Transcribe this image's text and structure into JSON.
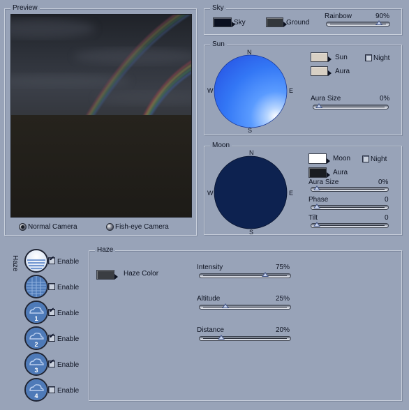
{
  "preview": {
    "title": "Preview",
    "normal_camera_label": "Normal Camera",
    "fisheye_camera_label": "Fish-eye Camera",
    "selected_camera": "normal"
  },
  "sky": {
    "title": "Sky",
    "sky_label": "Sky",
    "sky_color": "#0a1020",
    "ground_label": "Ground",
    "ground_color": "#33373c",
    "rainbow_label": "Rainbow",
    "rainbow_value": "90%",
    "rainbow_level": 0.9
  },
  "sun": {
    "title": "Sun",
    "sun_label": "Sun",
    "sun_color": "#d8d0c4",
    "aura_label": "Aura",
    "aura_color": "#d8d0c4",
    "night_label": "Night",
    "night_checked": false,
    "aura_size_label": "Aura Size",
    "aura_size_value": "0%",
    "aura_size_level": 0,
    "compass": {
      "n": "N",
      "s": "S",
      "e": "E",
      "w": "W"
    }
  },
  "moon": {
    "title": "Moon",
    "moon_label": "Moon",
    "moon_color": "#ffffff",
    "aura_label": "Aura",
    "aura_color": "#1a1d22",
    "night_label": "Night",
    "night_checked": false,
    "aura_size_label": "Aura Size",
    "aura_size_value": "0%",
    "aura_size_level": 0,
    "phase_label": "Phase",
    "phase_value": "0",
    "phase_level": 0,
    "tilt_label": "Tilt",
    "tilt_value": "0",
    "tilt_level": 0,
    "compass": {
      "n": "N",
      "s": "S",
      "e": "E",
      "w": "W"
    }
  },
  "haze_layers": {
    "side_label": "Haze",
    "items": [
      {
        "enable_label": "Enable",
        "checked": true,
        "icon": "haze-layer-icon",
        "number": ""
      },
      {
        "enable_label": "Enable",
        "checked": false,
        "icon": "haze-grid-icon",
        "number": ""
      },
      {
        "enable_label": "Enable",
        "checked": true,
        "icon": "cloud-layer-icon",
        "number": "1"
      },
      {
        "enable_label": "Enable",
        "checked": true,
        "icon": "cloud-layer-icon",
        "number": "2"
      },
      {
        "enable_label": "Enable",
        "checked": true,
        "icon": "cloud-layer-icon",
        "number": "3"
      },
      {
        "enable_label": "Enable",
        "checked": false,
        "icon": "cloud-layer-icon",
        "number": "4"
      }
    ]
  },
  "haze": {
    "title": "Haze",
    "haze_color_label": "Haze Color",
    "haze_color": "#3a3d42",
    "intensity_label": "Intensity",
    "intensity_value": "75%",
    "intensity_level": 0.75,
    "altitude_label": "Altitude",
    "altitude_value": "25%",
    "altitude_level": 0.25,
    "distance_label": "Distance",
    "distance_value": "20%",
    "distance_level": 0.2
  }
}
